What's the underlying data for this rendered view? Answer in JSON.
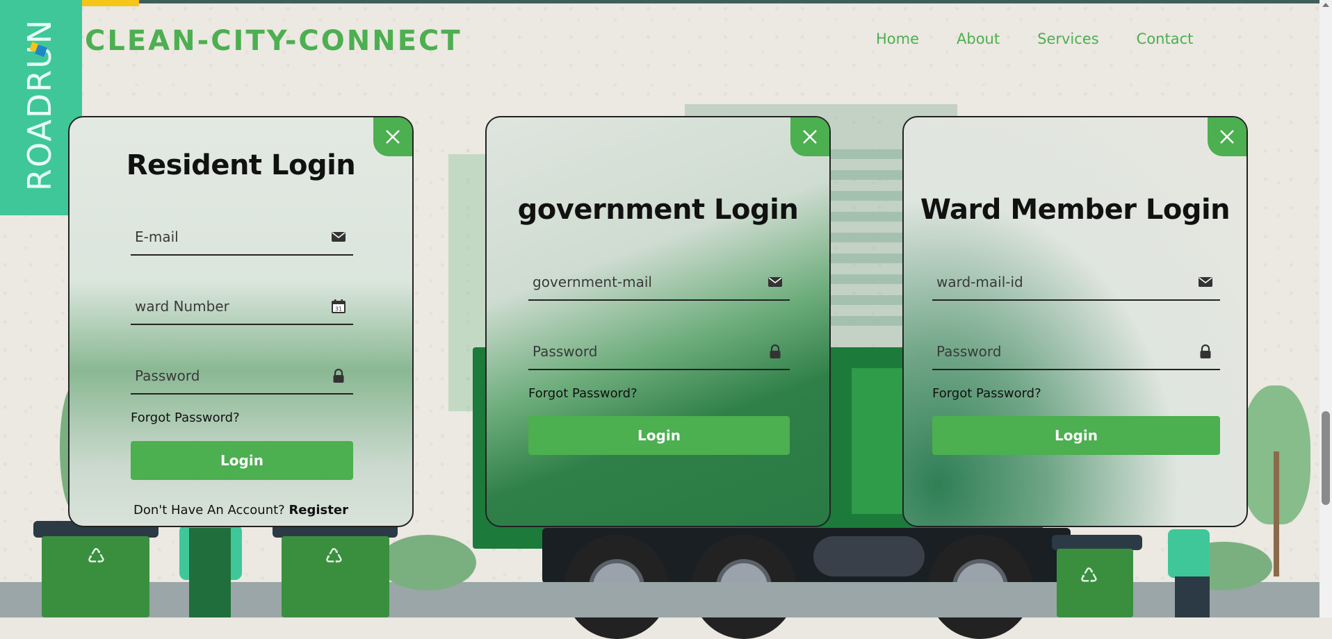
{
  "header": {
    "brand_strip_text": "ROADRUN",
    "site_title": "CLEAN-CITY-CONNECT",
    "nav": [
      "Home",
      "About",
      "Services",
      "Contact"
    ]
  },
  "resident": {
    "title": "Resident Login",
    "email_placeholder": "E-mail",
    "ward_placeholder": "ward Number",
    "password_placeholder": "Password",
    "forgot": "Forgot Password?",
    "login": "Login",
    "no_account": "Don't Have An Account? ",
    "register": "Register"
  },
  "government": {
    "title": "government Login",
    "email_placeholder": "government-mail",
    "password_placeholder": "Password",
    "forgot": "Forgot Password?",
    "login": "Login"
  },
  "ward": {
    "title": "Ward Member Login",
    "email_placeholder": "ward-mail-id",
    "password_placeholder": "Password",
    "forgot": "Forgot Password?",
    "login": "Login"
  },
  "icons": {
    "email": "mail-icon",
    "calendar": "calendar-icon",
    "password": "lock-icon",
    "close": "close-icon",
    "calendar_day": "31"
  },
  "colors": {
    "accent": "#4caf50",
    "brand_strip": "#3fc79a",
    "text": "#111111"
  }
}
